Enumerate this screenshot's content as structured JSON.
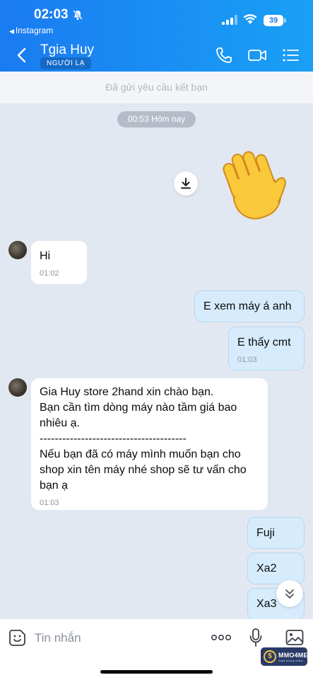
{
  "status_bar": {
    "time": "02:03",
    "back_app": "Instagram",
    "battery": "39"
  },
  "header": {
    "contact_name": "Tgia Huy",
    "badge": "NGƯỜI LẠ"
  },
  "friend_request": "Đã gửi yêu cầu kết bạn",
  "chat": {
    "time_separator": "00:53 Hôm nay",
    "messages": [
      {
        "dir": "in",
        "text": "Hi",
        "time": "01:02"
      },
      {
        "dir": "out",
        "text": "E xem máy á anh",
        "time": ""
      },
      {
        "dir": "out",
        "text": "E thấy cmt",
        "time": "01:03"
      },
      {
        "dir": "in",
        "text": "Gia Huy store 2hand xin chào bạn.\nBạn cần tìm dòng máy nào tầm giá bao nhiêu ạ.\n---------------------------------------\nNếu bạn đã có máy mình muốn bạn cho shop xin tên máy nhé shop sẽ tư vấn cho bạn ạ",
        "time": "01:03"
      },
      {
        "dir": "out",
        "text": "Fuji",
        "time": ""
      },
      {
        "dir": "out",
        "text": "Xa2",
        "time": ""
      },
      {
        "dir": "out",
        "text": "Xa3",
        "time": ""
      }
    ]
  },
  "composer": {
    "placeholder": "Tin nhắn"
  },
  "watermark": {
    "brand": "MMO4ME",
    "tagline": "make money online"
  },
  "colors": {
    "header_start": "#1a7bf2",
    "header_end": "#19a0f5",
    "chat_bg": "#e2e8f1",
    "outgoing_bubble": "#d6ecfd",
    "incoming_bubble": "#ffffff"
  }
}
